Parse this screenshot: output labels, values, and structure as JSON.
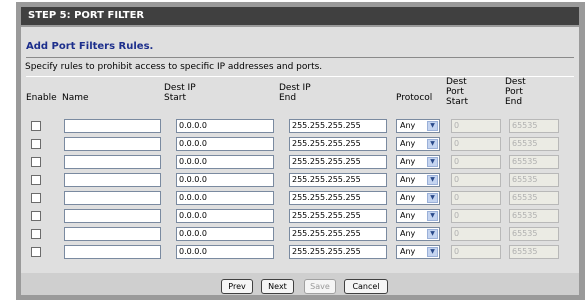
{
  "header": {
    "title": "STEP 5: PORT FILTER"
  },
  "section": {
    "title": "Add Port Filters Rules.",
    "description": "Specify rules to prohibit access to specific IP addresses and ports."
  },
  "columns": {
    "enable": "Enable",
    "name": "Name",
    "dest_ip_start": [
      "Dest IP",
      "Start"
    ],
    "dest_ip_end": [
      "Dest IP",
      "End"
    ],
    "protocol": "Protocol",
    "dest_port_start": [
      "Dest",
      "Port",
      "Start"
    ],
    "dest_port_end": [
      "Dest",
      "Port",
      "End"
    ]
  },
  "rows": [
    {
      "enabled": false,
      "name": "",
      "ip_start": "0.0.0.0",
      "ip_end": "255.255.255.255",
      "protocol": "Any",
      "port_start": "0",
      "port_end": "65535"
    },
    {
      "enabled": false,
      "name": "",
      "ip_start": "0.0.0.0",
      "ip_end": "255.255.255.255",
      "protocol": "Any",
      "port_start": "0",
      "port_end": "65535"
    },
    {
      "enabled": false,
      "name": "",
      "ip_start": "0.0.0.0",
      "ip_end": "255.255.255.255",
      "protocol": "Any",
      "port_start": "0",
      "port_end": "65535"
    },
    {
      "enabled": false,
      "name": "",
      "ip_start": "0.0.0.0",
      "ip_end": "255.255.255.255",
      "protocol": "Any",
      "port_start": "0",
      "port_end": "65535"
    },
    {
      "enabled": false,
      "name": "",
      "ip_start": "0.0.0.0",
      "ip_end": "255.255.255.255",
      "protocol": "Any",
      "port_start": "0",
      "port_end": "65535"
    },
    {
      "enabled": false,
      "name": "",
      "ip_start": "0.0.0.0",
      "ip_end": "255.255.255.255",
      "protocol": "Any",
      "port_start": "0",
      "port_end": "65535"
    },
    {
      "enabled": false,
      "name": "",
      "ip_start": "0.0.0.0",
      "ip_end": "255.255.255.255",
      "protocol": "Any",
      "port_start": "0",
      "port_end": "65535"
    },
    {
      "enabled": false,
      "name": "",
      "ip_start": "0.0.0.0",
      "ip_end": "255.255.255.255",
      "protocol": "Any",
      "port_start": "0",
      "port_end": "65535"
    }
  ],
  "buttons": {
    "prev": "Prev",
    "next": "Next",
    "save": "Save",
    "cancel": "Cancel"
  },
  "colors": {
    "header_bg": "#404040",
    "title_blue": "#1d2f8c",
    "panel_bg": "#dfdfdf"
  }
}
